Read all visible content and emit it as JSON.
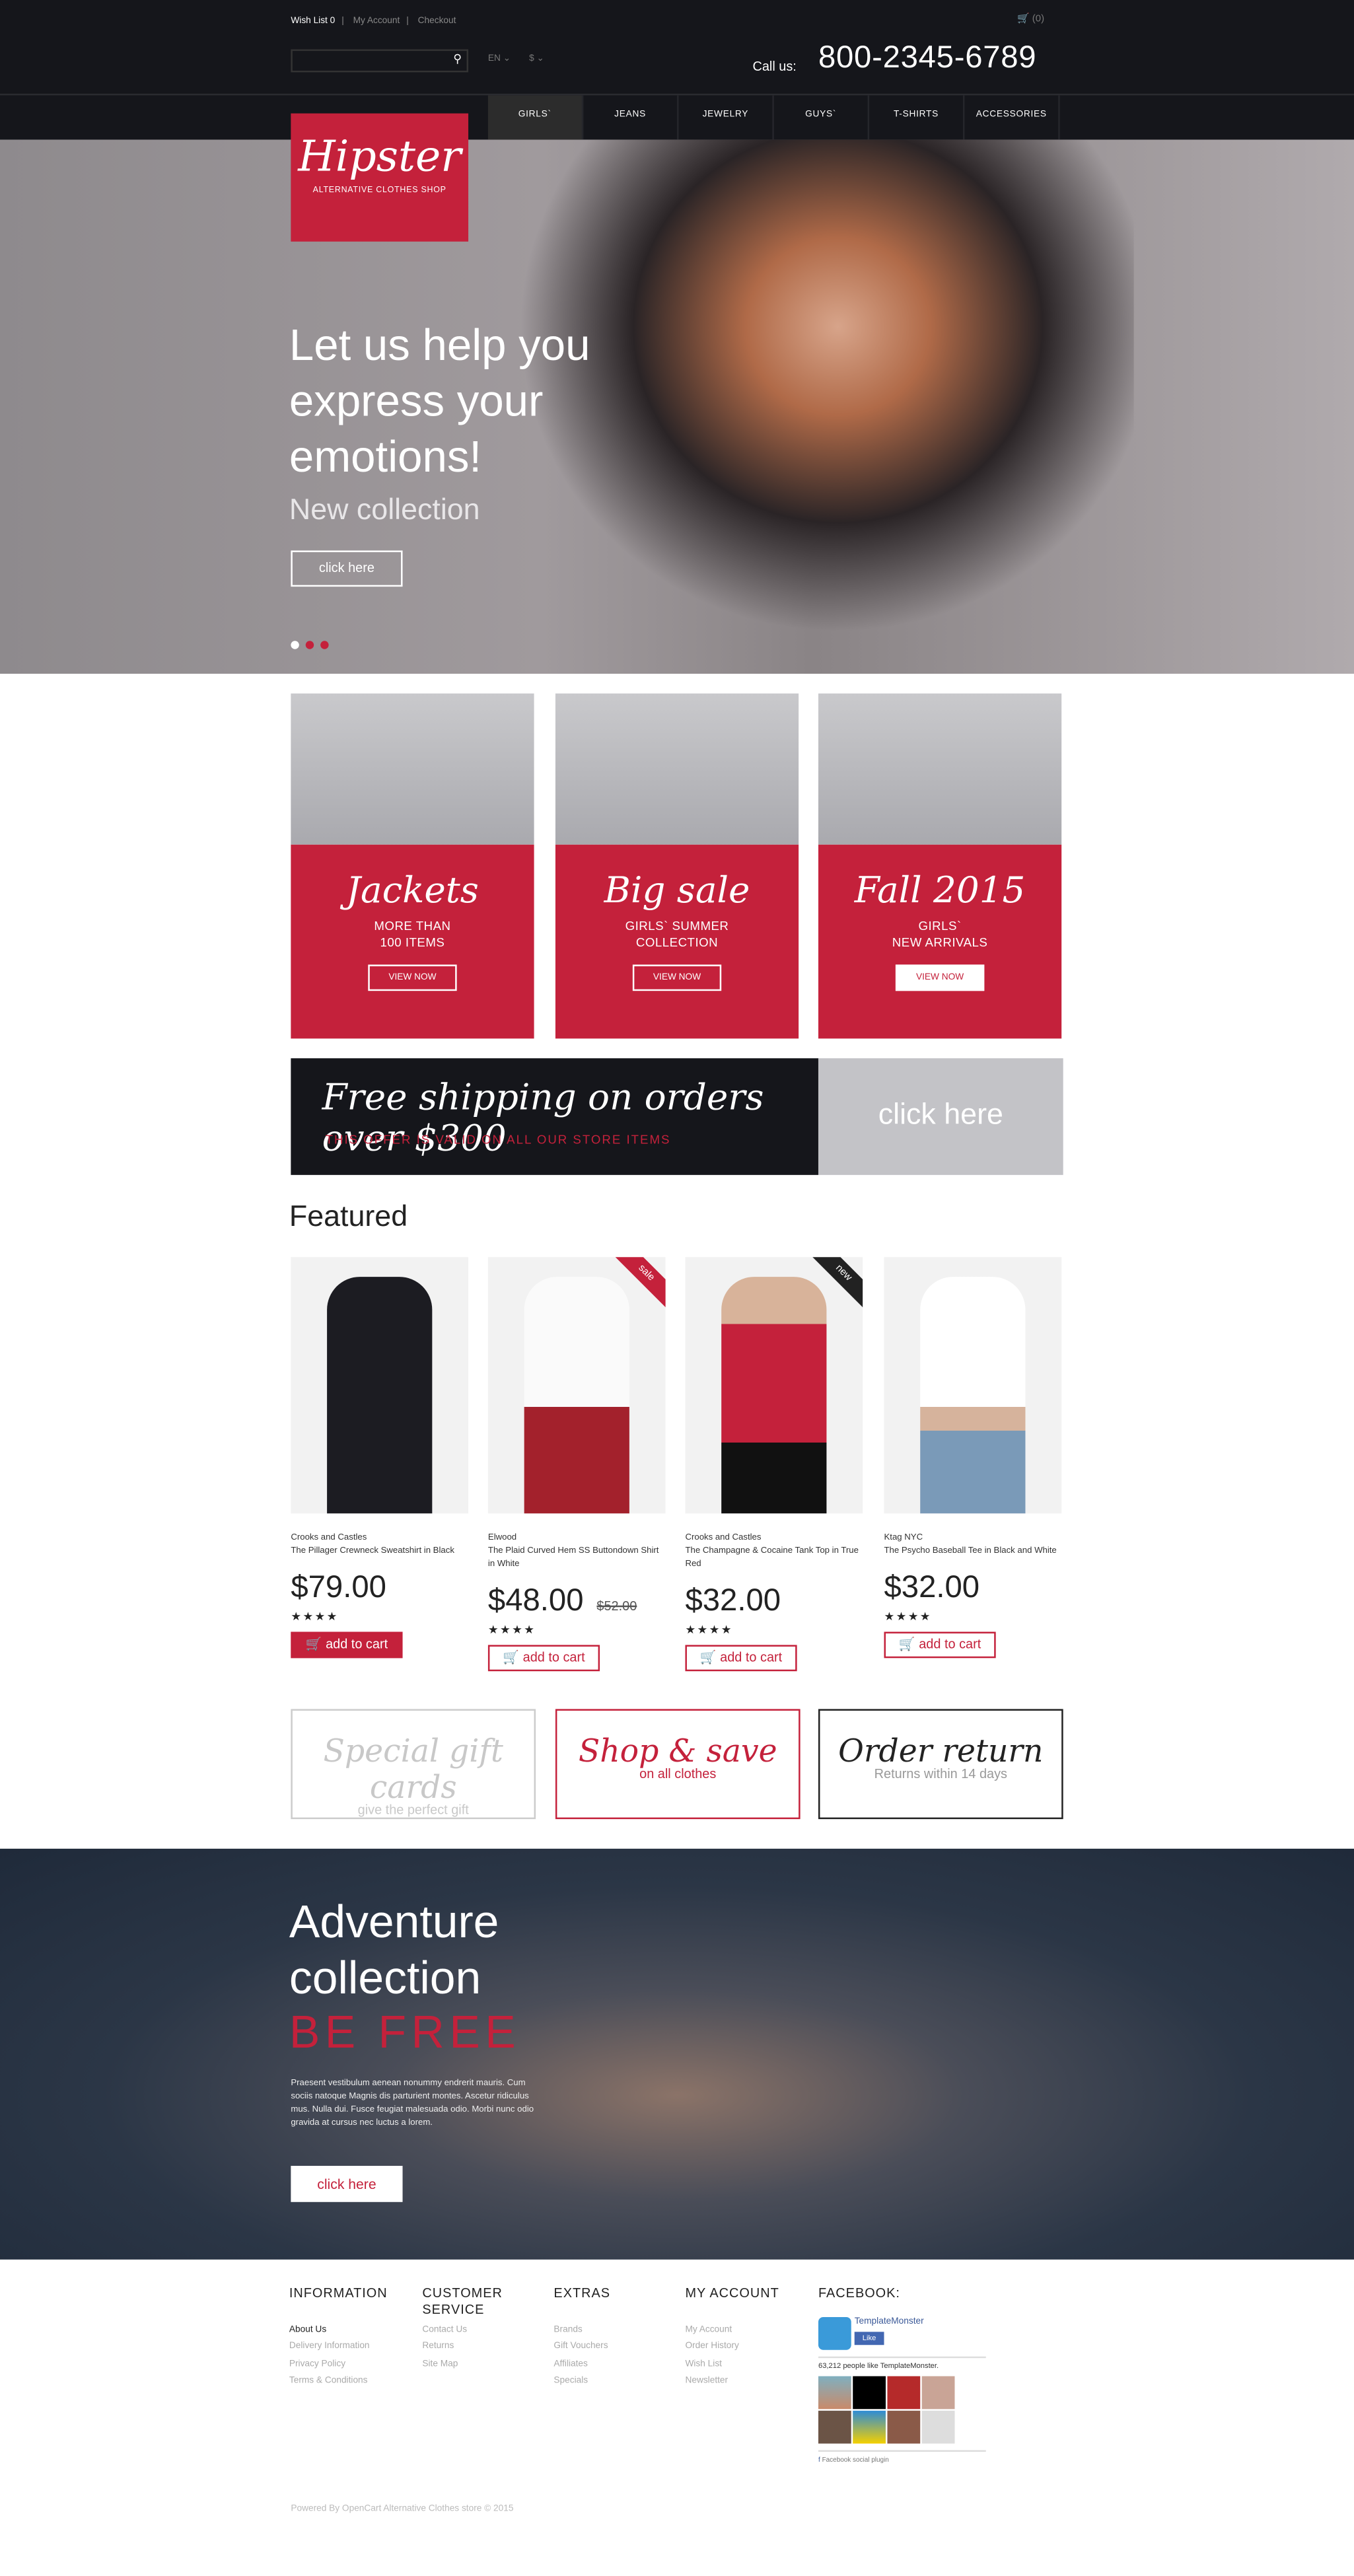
{
  "header": {
    "wish_list": "Wish List 0",
    "my_account": "My Account",
    "checkout": "Checkout",
    "cart_count": "(0)",
    "search_placeholder": "",
    "language": "EN",
    "currency": "$",
    "call_label": "Call us:",
    "phone": "800-2345-6789"
  },
  "nav": [
    "GIRLS`",
    "JEANS",
    "JEWELRY",
    "GUYS`",
    "T-SHIRTS",
    "ACCESSORIES"
  ],
  "logo": {
    "title": "Hipster",
    "subtitle": "ALTERNATIVE CLOTHES SHOP"
  },
  "hero": {
    "lines": [
      "Let us help you",
      "express your",
      "emotions!"
    ],
    "subtitle": "New collection",
    "button": "click here",
    "slides": 3,
    "active_slide": 1
  },
  "banners": [
    {
      "title": "Jackets",
      "lines": [
        "MORE THAN",
        "100 ITEMS"
      ],
      "button": "VIEW NOW"
    },
    {
      "title": "Big sale",
      "lines": [
        "GIRLS` SUMMER",
        "COLLECTION"
      ],
      "button": "VIEW NOW"
    },
    {
      "title": "Fall 2015",
      "lines": [
        "GIRLS`",
        "NEW ARRIVALS"
      ],
      "button": "VIEW NOW"
    }
  ],
  "shipping": {
    "title": "Free shipping on orders over $300",
    "subtitle": "THIS OFFER IS VALID ON ALL OUR STORE ITEMS",
    "button": "click here"
  },
  "featured": {
    "title": "Featured",
    "products": [
      {
        "brand": "Crooks and Castles",
        "name": "The Pillager Crewneck Sweatshirt in Black",
        "price": "$79.00",
        "old_price": "",
        "badge": "",
        "stars": "★★★★",
        "cart": "add to cart"
      },
      {
        "brand": "Elwood",
        "name": "The Plaid Curved Hem SS Buttondown Shirt in White",
        "price": "$48.00",
        "old_price": "$52.00",
        "badge": "sale",
        "stars": "★★★★",
        "cart": "add to cart"
      },
      {
        "brand": "Crooks and Castles",
        "name": "The Champagne & Cocaine Tank Top in True Red",
        "price": "$32.00",
        "old_price": "",
        "badge": "new",
        "stars": "★★★★",
        "cart": "add to cart"
      },
      {
        "brand": "Ktag NYC",
        "name": "The Psycho Baseball Tee in Black and White",
        "price": "$32.00",
        "old_price": "",
        "badge": "",
        "stars": "★★★★",
        "cart": "add to cart"
      }
    ]
  },
  "promos": [
    {
      "title": "Special gift cards",
      "subtitle": "give the perfect gift"
    },
    {
      "title": "Shop & save",
      "subtitle": "on all clothes"
    },
    {
      "title": "Order return",
      "subtitle": "Returns within 14 days"
    }
  ],
  "adventure": {
    "lines": [
      "Adventure",
      "collection"
    ],
    "accent": "BE  FREE",
    "text": "Praesent vestibulum aenean nonummy endrerit mauris. Cum sociis natoque Magnis dis parturient montes. Ascetur ridiculus mus. Nulla dui. Fusce feugiat malesuada odio. Morbi nunc odio gravida at cursus nec luctus a lorem.",
    "button": "click here"
  },
  "footer": {
    "columns": [
      {
        "title": "INFORMATION",
        "links": [
          "About Us",
          "Delivery Information",
          "Privacy Policy",
          "Terms & Conditions"
        ]
      },
      {
        "title": "CUSTOMER SERVICE",
        "links": [
          "Contact Us",
          "Returns",
          "Site Map"
        ]
      },
      {
        "title": "EXTRAS",
        "links": [
          "Brands",
          "Gift Vouchers",
          "Affiliates",
          "Specials"
        ]
      },
      {
        "title": "MY ACCOUNT",
        "links": [
          "My Account",
          "Order History",
          "Wish List",
          "Newsletter"
        ]
      }
    ],
    "facebook": {
      "title": "FACEBOOK:",
      "page": "TemplateMonster",
      "like": "Like",
      "count": "63,212 people like TemplateMonster.",
      "plugin": "Facebook social plugin"
    },
    "copyright": "Powered By OpenCart Alternative Clothes store © 2015"
  },
  "colors": {
    "accent": "#c4213b",
    "dark": "#15161b"
  }
}
